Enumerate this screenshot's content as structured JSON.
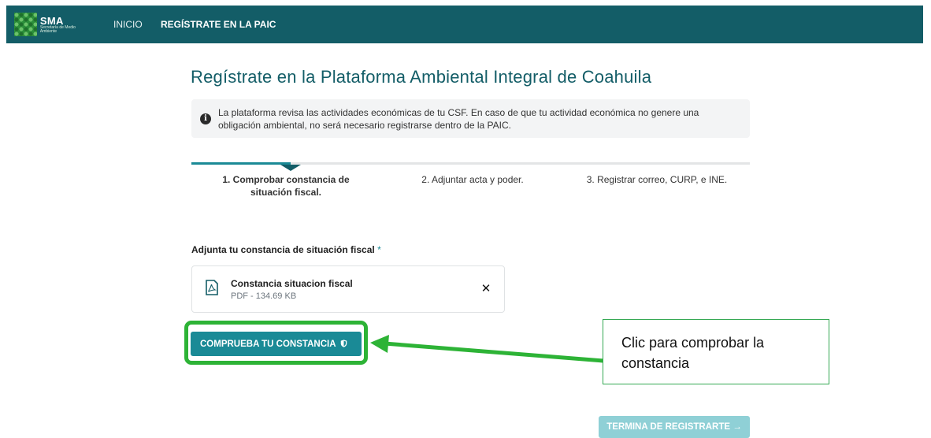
{
  "navbar": {
    "logo_title": "SMA",
    "logo_subtitle": "Secretaría de Medio Ambiente",
    "links": [
      {
        "label": "INICIO"
      },
      {
        "label": "REGÍSTRATE EN LA PAIC"
      }
    ]
  },
  "page_title": "Regístrate en la Plataforma Ambiental Integral de Coahuila",
  "info": {
    "icon": "info-circle-icon",
    "text": "La plataforma revisa las actividades económicas de tu CSF. En caso de que tu actividad económica no genere una obligación ambiental, no será necesario registrarse dentro de la PAIC."
  },
  "steps": [
    {
      "label": "1. Comprobar constancia de situación fiscal.",
      "active": true
    },
    {
      "label": "2. Adjuntar acta y poder.",
      "active": false
    },
    {
      "label": "3. Registrar correo, CURP, e INE.",
      "active": false
    }
  ],
  "upload": {
    "label": "Adjunta tu constancia de situación fiscal",
    "required_mark": "*",
    "file_name": "Constancia situacion fiscal",
    "file_meta": "PDF - 134.69 KB",
    "remove_icon": "close-icon"
  },
  "check_button": {
    "label": "COMPRUEBA TU CONSTANCIA",
    "icon": "shield-icon"
  },
  "callout": {
    "text": "Clic para comprobar la constancia"
  },
  "finish_button": {
    "label": "TERMINA DE REGISTRARTE →"
  },
  "colors": {
    "primary": "#135d67",
    "accent": "#1a8a96",
    "highlight": "#2db336",
    "info_bg": "#f3f4f5",
    "disabled_button": "#8fd0d6"
  }
}
